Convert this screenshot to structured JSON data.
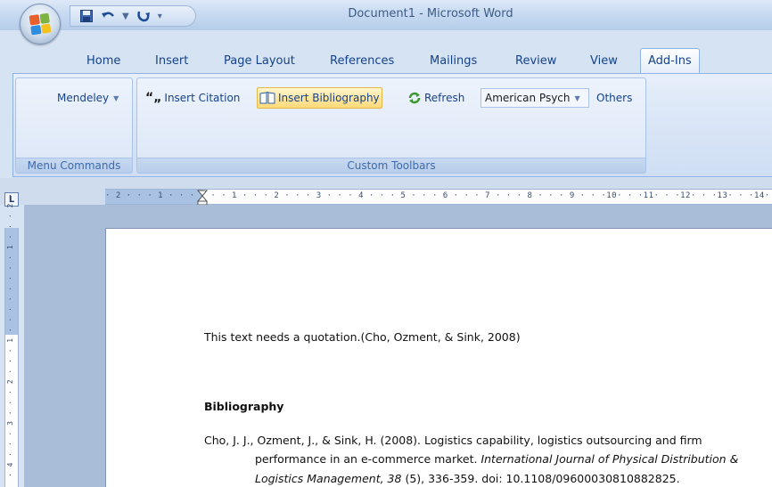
{
  "window": {
    "title": "Document1 - Microsoft Word"
  },
  "quick_access": {
    "save_icon": "save-icon",
    "undo_icon": "undo-icon",
    "redo_icon": "redo-icon",
    "customize_icon": "customize-qat-icon"
  },
  "tabs": [
    {
      "label": "Home"
    },
    {
      "label": "Insert"
    },
    {
      "label": "Page Layout"
    },
    {
      "label": "References"
    },
    {
      "label": "Mailings"
    },
    {
      "label": "Review"
    },
    {
      "label": "View"
    },
    {
      "label": "Add-Ins"
    }
  ],
  "active_tab": "Add-Ins",
  "ribbon": {
    "menu_commands": {
      "label": "Menu Commands",
      "mendeley": "Mendeley"
    },
    "custom_toolbars": {
      "label": "Custom Toolbars",
      "insert_citation": "Insert Citation",
      "insert_bibliography": "Insert Bibliography",
      "refresh": "Refresh",
      "style_value": "American Psych",
      "others": "Others"
    }
  },
  "rulers": {
    "horizontal": "· 2 · · · 1 · · ·    · · · 1 · · · 2 · · · 3 · · · 4 · · · 5 · · · 6 · · · 7 · · · 8 · · · 9 · · ·10· · ·11· · ·12· · ·13· · ·14· · ·",
    "vertical": "· 4 · · · 3 · · · 2 · · · 1 · · · · · · · · 1 · · · 2 ·",
    "corner_label": "L"
  },
  "document": {
    "line1": "This text needs a quotation.(Cho, Ozment, & Sink, 2008)",
    "heading": "Bibliography",
    "ref_line1": "Cho, J. J., Ozment, J., & Sink, H. (2008). Logistics capability, logistics outsourcing and firm",
    "ref_line2_plain": "performance in an e-commerce market. ",
    "ref_line2_italic": "International Journal of Physical Distribution &",
    "ref_line3_italic": "Logistics Management, 38",
    "ref_line3_plain": " (5), 336-359. doi: 10.1108/09600030810882825."
  },
  "colors": {
    "accent": "#15428b",
    "ribbon_bg": "#dbe7f7",
    "highlight": "#ffd978"
  }
}
